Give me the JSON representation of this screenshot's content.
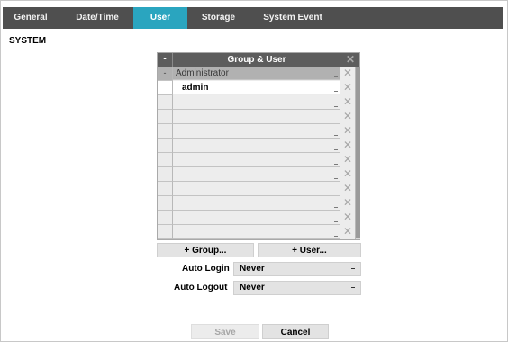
{
  "tabs": [
    {
      "label": "General"
    },
    {
      "label": "Date/Time"
    },
    {
      "label": "User"
    },
    {
      "label": "Storage"
    },
    {
      "label": "System Event"
    }
  ],
  "section_title": "SYSTEM",
  "grid": {
    "header_title": "Group & User",
    "header_toggle": "-",
    "delete_icon": "✕",
    "group_toggle": "-",
    "group_name": "Administrator",
    "user_name": "admin"
  },
  "buttons": {
    "add_group": "+ Group...",
    "add_user": "+ User...",
    "save": "Save",
    "cancel": "Cancel"
  },
  "auto_login": {
    "label": "Auto Login",
    "value": "Never"
  },
  "auto_logout": {
    "label": "Auto Logout",
    "value": "Never"
  },
  "colors": {
    "tab_bar": "#4f4f4f",
    "active_tab": "#2aa5bf",
    "grid_header": "#5d5d5d"
  }
}
